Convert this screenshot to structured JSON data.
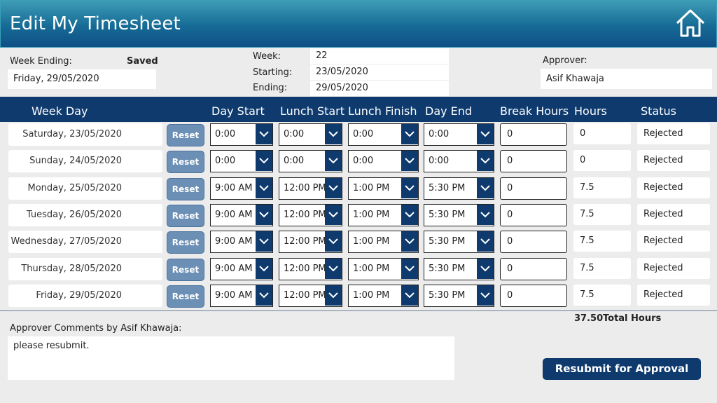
{
  "header": {
    "title": "Edit My Timesheet",
    "home_icon": "home-icon"
  },
  "summary": {
    "week_ending_label": "Week Ending:",
    "saved_label": "Saved",
    "week_ending_value": "Friday, 29/05/2020",
    "week_label": "Week:",
    "week_value": "22",
    "starting_label": "Starting:",
    "starting_value": "23/05/2020",
    "ending_label": "Ending:",
    "ending_value": "29/05/2020",
    "approver_label": "Approver:",
    "approver_value": "Asif Khawaja"
  },
  "grid": {
    "headers": [
      "Week Day",
      "Day Start",
      "Lunch Start",
      "Lunch Finish",
      "Day End",
      "Break Hours",
      "Hours",
      "Status"
    ],
    "reset_label": "Reset",
    "rows": [
      {
        "day": "Saturday, 23/05/2020",
        "day_start": "0:00",
        "lunch_start": "0:00",
        "lunch_finish": "0:00",
        "day_end": "0:00",
        "break_hours": "0",
        "hours": "0",
        "status": "Rejected"
      },
      {
        "day": "Sunday, 24/05/2020",
        "day_start": "0:00",
        "lunch_start": "0:00",
        "lunch_finish": "0:00",
        "day_end": "0:00",
        "break_hours": "0",
        "hours": "0",
        "status": "Rejected"
      },
      {
        "day": "Monday, 25/05/2020",
        "day_start": "9:00 AM",
        "lunch_start": "12:00 PM",
        "lunch_finish": "1:00 PM",
        "day_end": "5:30 PM",
        "break_hours": "0",
        "hours": "7.5",
        "status": "Rejected"
      },
      {
        "day": "Tuesday, 26/05/2020",
        "day_start": "9:00 AM",
        "lunch_start": "12:00 PM",
        "lunch_finish": "1:00 PM",
        "day_end": "5:30 PM",
        "break_hours": "0",
        "hours": "7.5",
        "status": "Rejected"
      },
      {
        "day": "Wednesday, 27/05/2020",
        "day_start": "9:00 AM",
        "lunch_start": "12:00 PM",
        "lunch_finish": "1:00 PM",
        "day_end": "5:30 PM",
        "break_hours": "0",
        "hours": "7.5",
        "status": "Rejected"
      },
      {
        "day": "Thursday, 28/05/2020",
        "day_start": "9:00 AM",
        "lunch_start": "12:00 PM",
        "lunch_finish": "1:00 PM",
        "day_end": "5:30 PM",
        "break_hours": "0",
        "hours": "7.5",
        "status": "Rejected"
      },
      {
        "day": "Friday, 29/05/2020",
        "day_start": "9:00 AM",
        "lunch_start": "12:00 PM",
        "lunch_finish": "1:00 PM",
        "day_end": "5:30 PM",
        "break_hours": "0",
        "hours": "7.5",
        "status": "Rejected"
      }
    ]
  },
  "totals": {
    "value": "37.50",
    "label": "Total Hours"
  },
  "comments": {
    "label": "Approver Comments by Asif Khawaja:",
    "text": "please resubmit."
  },
  "actions": {
    "resubmit_label": "Resubmit for Approval"
  },
  "colors": {
    "header_start": "#3e9cb6",
    "header_end": "#0f4f86",
    "navy": "#0e3a6e",
    "reset": "#6b8fb5"
  }
}
